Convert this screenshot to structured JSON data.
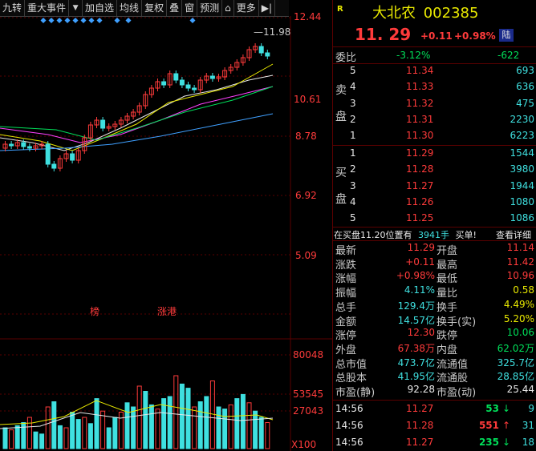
{
  "toolbar": {
    "items": [
      "九转",
      "重大事件",
      "加自选",
      "均线",
      "复权",
      "叠",
      "窗",
      "预测",
      "更多"
    ],
    "dropdown_glyph": "▼",
    "lock_glyph": "⌂",
    "panel_toggle_glyph": "▶|"
  },
  "price_axis": [
    "12.44",
    "10.61",
    "8.78",
    "6.92",
    "5.09"
  ],
  "volume_axis": [
    "80048",
    "53545",
    "27043",
    "X100"
  ],
  "chart": {
    "high_label": "11.98",
    "annotations": [
      "榜",
      "涨港"
    ]
  },
  "header": {
    "badge": "R",
    "name": "大北农",
    "code": "002385",
    "price": "11. 29",
    "change": "+0.11",
    "change_pct": "+0.98%",
    "market_tag": "陆"
  },
  "ratio": {
    "label": "委比",
    "value": "-3.12%",
    "diff": "-622"
  },
  "sell_label": [
    "卖",
    "盘"
  ],
  "buy_label": [
    "买",
    "盘"
  ],
  "sell": [
    {
      "level": "5",
      "price": "11.34",
      "vol": "693"
    },
    {
      "level": "4",
      "price": "11.33",
      "vol": "636"
    },
    {
      "level": "3",
      "price": "11.32",
      "vol": "475"
    },
    {
      "level": "2",
      "price": "11.31",
      "vol": "2230"
    },
    {
      "level": "1",
      "price": "11.30",
      "vol": "6223"
    }
  ],
  "buy": [
    {
      "level": "1",
      "price": "11.29",
      "vol": "1544"
    },
    {
      "level": "2",
      "price": "11.28",
      "vol": "3980"
    },
    {
      "level": "3",
      "price": "11.27",
      "vol": "1944"
    },
    {
      "level": "4",
      "price": "11.26",
      "vol": "1080"
    },
    {
      "level": "5",
      "price": "11.25",
      "vol": "1086"
    }
  ],
  "notice": {
    "text": "在买盘11.20位置有",
    "qty": "3941手",
    "action": "买单!",
    "link": "查看详细"
  },
  "stats": [
    {
      "l1": "最新",
      "v1": "11.29",
      "c1": "red",
      "l2": "开盘",
      "v2": "11.14",
      "c2": "red"
    },
    {
      "l1": "涨跌",
      "v1": "+0.11",
      "c1": "red",
      "l2": "最高",
      "v2": "11.42",
      "c2": "red"
    },
    {
      "l1": "涨幅",
      "v1": "+0.98%",
      "c1": "red",
      "l2": "最低",
      "v2": "10.96",
      "c2": "red"
    },
    {
      "l1": "振幅",
      "v1": "4.11%",
      "c1": "cyan",
      "l2": "量比",
      "v2": "0.58",
      "c2": "yellow"
    },
    {
      "l1": "总手",
      "v1": "129.4万",
      "c1": "cyan",
      "l2": "换手",
      "v2": "4.49%",
      "c2": "yellow"
    },
    {
      "l1": "金额",
      "v1": "14.57亿",
      "c1": "cyan",
      "l2": "换手(实)",
      "v2": "5.20%",
      "c2": "yellow"
    },
    {
      "l1": "涨停",
      "v1": "12.30",
      "c1": "red",
      "l2": "跌停",
      "v2": "10.06",
      "c2": "green"
    },
    {
      "l1": "外盘",
      "v1": "67.38万",
      "c1": "red",
      "l2": "内盘",
      "v2": "62.02万",
      "c2": "green"
    },
    {
      "l1": "总市值",
      "v1": "473.7亿",
      "c1": "cyan",
      "l2": "流通值",
      "v2": "325.7亿",
      "c2": "cyan"
    },
    {
      "l1": "总股本",
      "v1": "41.95亿",
      "c1": "cyan",
      "l2": "流通股",
      "v2": "28.85亿",
      "c2": "cyan"
    },
    {
      "l1": "市盈(静)",
      "v1": "92.28",
      "c1": "white",
      "l2": "市盈(动)",
      "v2": "25.44",
      "c2": "white"
    }
  ],
  "ticks": [
    {
      "time": "14:56",
      "price": "11.27",
      "vol": "53",
      "dir": "down",
      "n": "9"
    },
    {
      "time": "14:56",
      "price": "11.28",
      "vol": "551",
      "dir": "up",
      "n": "31"
    },
    {
      "time": "14:56",
      "price": "11.27",
      "vol": "235",
      "dir": "down",
      "n": "18"
    }
  ],
  "colors": {
    "up": "#ff3b3b",
    "down": "#00e05a",
    "cyan": "#3fe0e0",
    "yellow": "#e8e800",
    "grid": "#5a0000",
    "up_candle": "#ff3b3b",
    "down_candle": "#3fe0e0"
  }
}
